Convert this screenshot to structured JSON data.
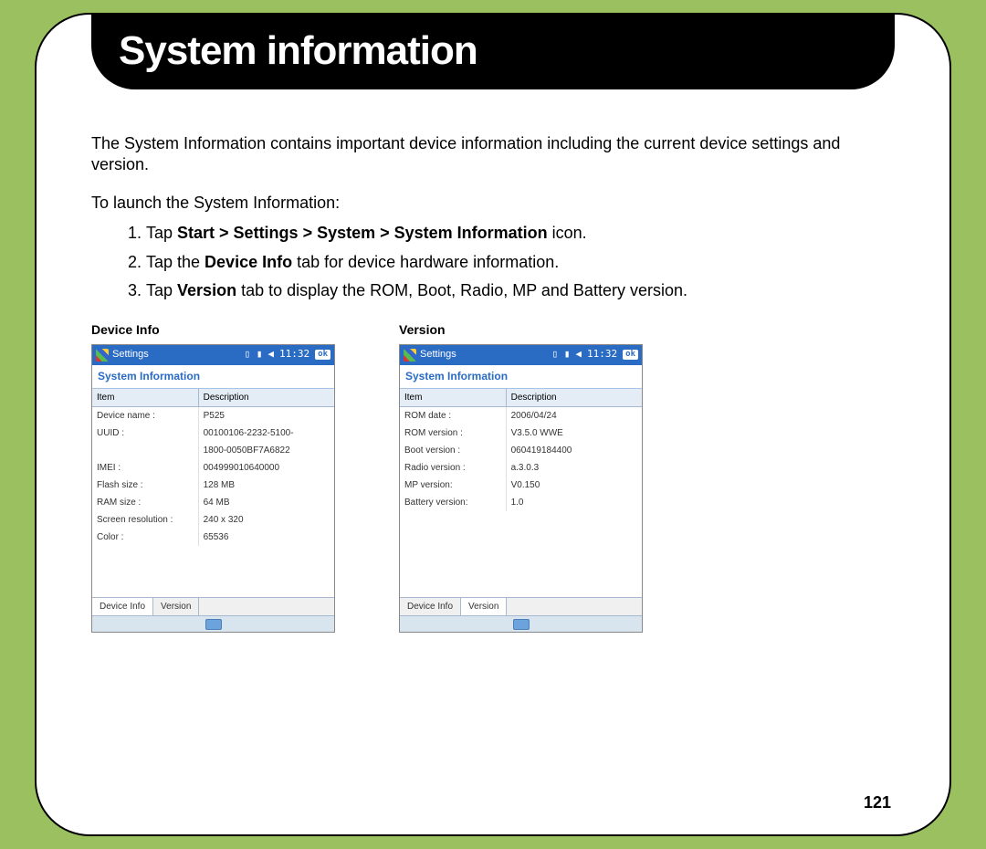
{
  "title": "System information",
  "intro": "The System Information contains important device information including the current device settings and version.",
  "launch_label": "To launch the System Information:",
  "steps": {
    "s1_tap": "Tap ",
    "s1_path": "Start > Settings > System > System Information",
    "s1_rest": " icon.",
    "s2_pre": "Tap the ",
    "s2_bold": "Device Info",
    "s2_post": " tab for device hardware information.",
    "s3_pre": "Tap ",
    "s3_bold": "Version",
    "s3_post": " tab to display the ROM, Boot, Radio, MP and Battery version."
  },
  "screenshots": {
    "left_caption": "Device Info",
    "right_caption": "Version",
    "titlebar_label": "Settings",
    "status_time": "11:32",
    "ok_label": "ok",
    "screen_header": "System Information",
    "col_item": "Item",
    "col_desc": "Description",
    "tab_device": "Device Info",
    "tab_version": "Version",
    "device_rows": [
      {
        "item": "Device name :",
        "desc": "P525"
      },
      {
        "item": "UUID :",
        "desc": "00100106-2232-5100-"
      },
      {
        "item": "",
        "desc": "1800-0050BF7A6822"
      },
      {
        "item": "IMEI :",
        "desc": "004999010640000"
      },
      {
        "item": "Flash size :",
        "desc": "128 MB"
      },
      {
        "item": "RAM size :",
        "desc": "64 MB"
      },
      {
        "item": "Screen resolution :",
        "desc": "240 x 320"
      },
      {
        "item": "Color :",
        "desc": "65536"
      }
    ],
    "version_rows": [
      {
        "item": "ROM date :",
        "desc": "2006/04/24"
      },
      {
        "item": "ROM version :",
        "desc": "V3.5.0 WWE"
      },
      {
        "item": "Boot version :",
        "desc": "060419184400"
      },
      {
        "item": "Radio version :",
        "desc": "a.3.0.3"
      },
      {
        "item": "MP version:",
        "desc": "V0.150"
      },
      {
        "item": "Battery version:",
        "desc": "1.0"
      }
    ]
  },
  "page_number": "121"
}
